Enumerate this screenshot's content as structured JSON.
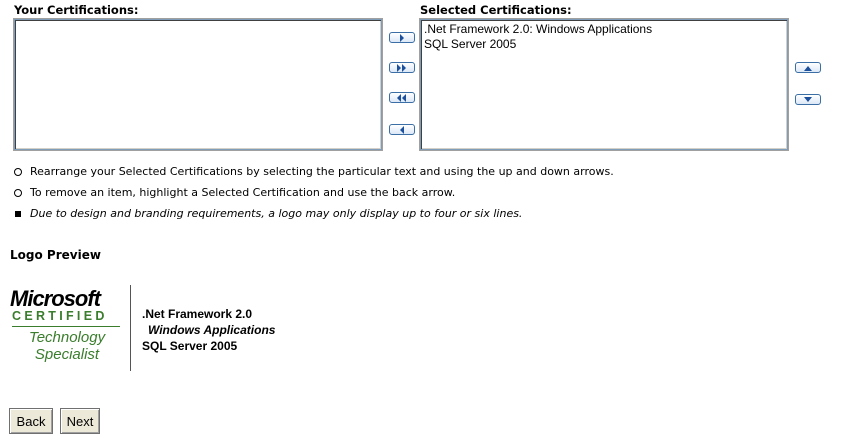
{
  "your_certs": {
    "label": "Your Certifications:",
    "items": []
  },
  "selected_certs": {
    "label": "Selected Certifications:",
    "items": [
      ".Net Framework 2.0: Windows Applications",
      "SQL Server 2005"
    ]
  },
  "transfer_buttons": [
    "move-right",
    "move-all-right",
    "move-all-left",
    "move-left"
  ],
  "order_buttons": [
    "move-up",
    "move-down"
  ],
  "instructions": [
    "Rearrange your Selected Certifications by selecting the particular text and using the up and down arrows.",
    "To remove an item, highlight a Selected Certification and use the back arrow.",
    "Due to design and branding requirements, a logo may only display up to four or six lines."
  ],
  "logo_preview": {
    "heading": "Logo Preview",
    "logo": {
      "brand": "Microsoft",
      "line1": "CERTIFIED",
      "line2": "Technology",
      "line3": "Specialist"
    },
    "lines": [
      ".Net Framework 2.0",
      "Windows Applications",
      "SQL Server 2005"
    ]
  },
  "nav": {
    "back_label": "Back",
    "next_label": "Next"
  },
  "colors": {
    "accent": "#3a6ea5",
    "logo_green": "#3a7d2c"
  }
}
